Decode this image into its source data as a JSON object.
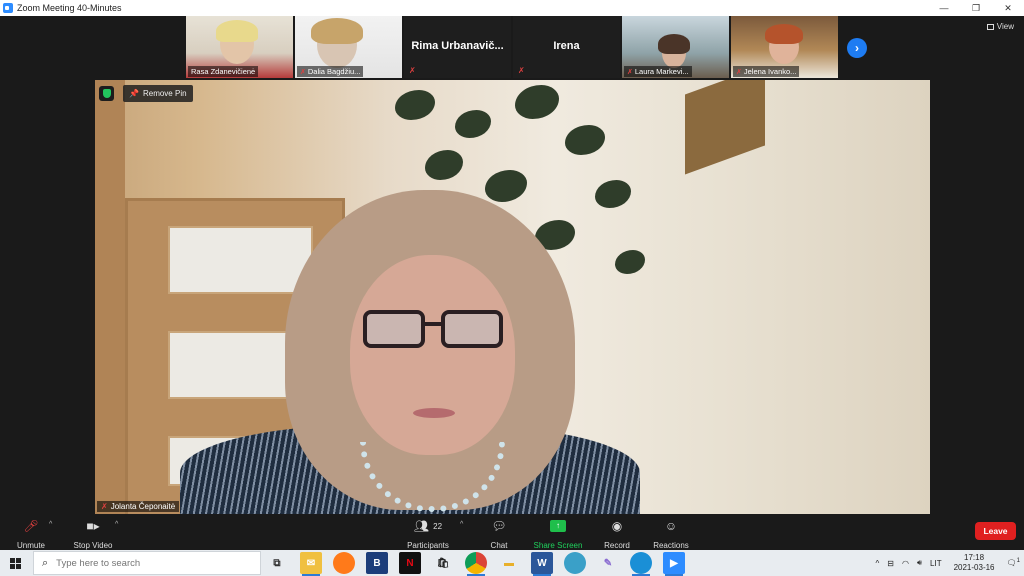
{
  "window": {
    "title": "Zoom Meeting 40-Minutes",
    "minimize": "—",
    "restore": "❐",
    "close": "✕"
  },
  "thumbnails": [
    {
      "name": "Rasa Zdanevičienė",
      "video": true
    },
    {
      "name": "Dalia Bagdžiu...",
      "video": true,
      "muted": true
    },
    {
      "name": "Rima  Urbanavič...",
      "video": false,
      "muted": true
    },
    {
      "name": "Irena",
      "video": false,
      "muted": true
    },
    {
      "name": "Laura Markevi...",
      "video": true,
      "muted": true
    },
    {
      "name": "Jelena Ivanko...",
      "video": true,
      "muted": true
    }
  ],
  "view_button": "View",
  "next_icon": "›",
  "main_video": {
    "participant_name": "Jolanta Čeponaitė",
    "remove_pin_label": "Remove Pin"
  },
  "toolbar": {
    "unmute": "Unmute",
    "stop_video": "Stop Video",
    "participants": "Participants",
    "participants_count": "22",
    "chat": "Chat",
    "share_screen": "Share Screen",
    "record": "Record",
    "reactions": "Reactions",
    "leave": "Leave"
  },
  "taskbar": {
    "search_placeholder": "Type here to search",
    "apps": [
      "task-view",
      "outlook",
      "firefox",
      "b-app",
      "netflix",
      "store",
      "chrome",
      "file-explorer",
      "word",
      "app-globe",
      "paint",
      "edge",
      "zoom"
    ],
    "tray": {
      "language": "LIT",
      "time": "17:18",
      "date": "2021-03-16",
      "notification_count": "1"
    }
  },
  "colors": {
    "accent": "#2d8cff",
    "leave": "#e02020",
    "share": "#1fbf4b",
    "muted": "#e04040"
  }
}
